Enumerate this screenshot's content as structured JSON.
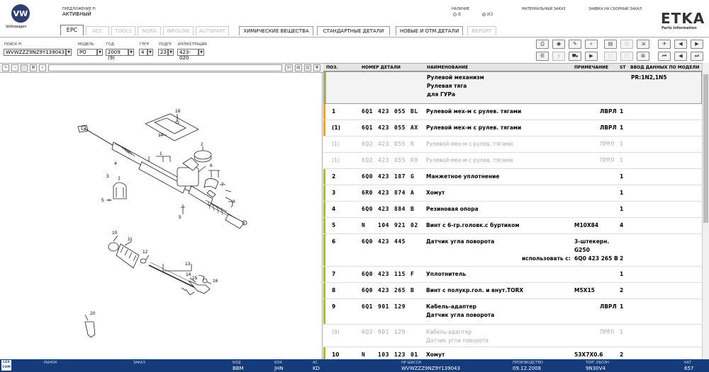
{
  "header": {
    "brand": "Volkswagen",
    "offer_label": "ПРЕДЛОЖЕНИЕ FI",
    "offer_value": "АКТИВНЫЙ",
    "availability_label": "НАЛИЧИЕ",
    "radio_b": "В",
    "radio_iz": "ИЗ",
    "material_order_label": "МАТЕРИАЛЬНЫЙ ЗАКАЗ",
    "assembly_order_label": "ЗАЯВКА НА СБОРНЫЙ ЗАКАЗ",
    "etka_title": "ETKA",
    "etka_subtitle": "Parts Information"
  },
  "tabs": [
    {
      "label": "EPC",
      "active": true
    },
    {
      "label": "ACC",
      "disabled": true
    },
    {
      "label": "TOOLS",
      "disabled": true
    },
    {
      "label": "NORA",
      "disabled": true
    },
    {
      "label": "INFOLINE",
      "disabled": true
    },
    {
      "label": "AUTOPART",
      "disabled": true
    },
    {
      "label": "ХИМИЧЕСКИЕ ВЕЩЕСТВА"
    },
    {
      "label": "СТАНДАРТНЫЕ ДЕТАЛИ"
    },
    {
      "label": "НОВЫЕ И ОТМ.ДЕТАЛИ"
    },
    {
      "label": "REPORT",
      "disabled": true
    }
  ],
  "search": {
    "search_label": "ПОИСК FI",
    "search_value": "WVWZZZ9NZ9Y139043",
    "model_label": "МОДЕЛЬ",
    "model_value": "PO",
    "year_label": "ГОД",
    "year_value": "2009 (9)",
    "group_label": "ГЛГР",
    "group_value": "4",
    "subgroup_label": "ПОДГР",
    "subgroup_value": "23",
    "illus_label": "ИЛЛЮСТРАЦИЯ",
    "illus_value": "423-020"
  },
  "table": {
    "headers": {
      "pos": "ПОЗ.",
      "part": "НОМЕР ДЕТАЛИ",
      "name": "НАИМЕНОВАНИЕ",
      "note": "ПРИМЕЧАНИЕ",
      "st": "ST",
      "model": "ВВОД ДАННЫХ ПО МОДЕЛИ"
    },
    "group_header": {
      "lines": [
        "Рулевой механизм",
        "Рулевая тяга",
        "для ГУРа"
      ],
      "model": "PR:1N2,1N5"
    },
    "rows": [
      {
        "pos": "1",
        "p1": "6Q1",
        "p2": "423",
        "p3": "055",
        "p4": "BL",
        "name": "Рулевой мех-м с рулев. тягами",
        "note": "ЛВРЛ",
        "st": "1",
        "bar": "#e8a33a"
      },
      {
        "pos": "(1)",
        "p1": "6Q1",
        "p2": "423",
        "p3": "055",
        "p4": "AX",
        "name": "Рулевой мех-м с рулев. тягами",
        "note": "ЛВРЛ",
        "st": "1",
        "bar": "#e8a33a"
      },
      {
        "pos": "(1)",
        "p1": "6Q2",
        "p2": "423",
        "p3": "055",
        "p4": "R",
        "name": "Рулевой мех-м с рулев. тягами",
        "note": "ПРРЛ",
        "st": "1",
        "gray": true
      },
      {
        "pos": "(1)",
        "p1": "6Q2",
        "p2": "423",
        "p3": "055",
        "p4": "RX",
        "name": "Рулевой мех-м с рулев. тягами",
        "note": "ПРРЛ",
        "st": "1",
        "gray": true
      },
      {
        "pos": "2",
        "p1": "6Q0",
        "p2": "423",
        "p3": "187",
        "p4": "G",
        "name": "Манжетное уплотнение",
        "note": "",
        "st": "1",
        "bar": "#a6b94a"
      },
      {
        "pos": "3",
        "p1": "6R0",
        "p2": "423",
        "p3": "874",
        "p4": "A",
        "name": "Хомут",
        "note": "",
        "st": "1",
        "bar": "#a6b94a"
      },
      {
        "pos": "4",
        "p1": "6Q0",
        "p2": "423",
        "p3": "884",
        "p4": "B",
        "name": "Резиновая опора",
        "note": "",
        "st": "1",
        "bar": "#a6b94a"
      },
      {
        "pos": "5",
        "p1": "N",
        "p2": "104",
        "p3": "921",
        "p4": "02",
        "name": "Винт с 6-гр.головк.с буртиком",
        "note": "M10X84",
        "st": "4",
        "bar": "#a6b94a"
      },
      {
        "pos": "6",
        "p1": "6Q0",
        "p2": "423",
        "p3": "445",
        "p4": "",
        "name": "Датчик угла поворота",
        "note": "3-штекерн.",
        "note2": "G250",
        "use_label": "использовать с:",
        "note3": "6Q0 423 265 B",
        "st": "2",
        "bar": "#a6b94a"
      },
      {
        "pos": "7",
        "p1": "6Q0",
        "p2": "423",
        "p3": "115",
        "p4": "F",
        "name": "Уплотнитель",
        "note": "",
        "st": "1",
        "bar": "#a6b94a"
      },
      {
        "pos": "8",
        "p1": "6Q0",
        "p2": "423",
        "p3": "265",
        "p4": "B",
        "name": "Винт с полукр.гол. и внут.TORX",
        "note": "M5X15",
        "st": "2",
        "bar": "#a6b94a"
      },
      {
        "pos": "9",
        "p1": "6Q1",
        "p2": "901",
        "p3": "129",
        "p4": "",
        "name": "Кабель-адаптер",
        "name2": "Датчик угла поворота",
        "note": "ЛВРЛ",
        "st": "1",
        "bar": "#a6b94a"
      },
      {
        "pos": "(9)",
        "p1": "6Q2",
        "p2": "901",
        "p3": "129",
        "p4": "",
        "name": "Кабель-адаптер",
        "name2": "Датчик угла поворота",
        "note": "ПРРЛ",
        "st": "1",
        "gray": true
      },
      {
        "pos": "10",
        "p1": "N",
        "p2": "103",
        "p3": "123",
        "p4": "01",
        "name": "Хомут",
        "note": "53X7X0.6",
        "st": "2",
        "bar": "#a6b94a"
      }
    ]
  },
  "diagram": {
    "labels": [
      "18",
      "17",
      "1",
      "2",
      "3",
      "4",
      "6",
      "7",
      "8",
      "5",
      "5",
      "10",
      "11",
      "12",
      "13",
      "14",
      "15",
      "16",
      "20"
    ]
  },
  "footer": {
    "logo": "LEX COM",
    "market_label": "РЫНОК",
    "order_label": "ЗАКАЗ",
    "bod_label": "БОД",
    "bod_value": "BBM",
    "bok_label": "БОК",
    "bok_value": "JHN",
    "ac_label": "АС",
    "ac_value": "KD",
    "vin_label": "НР ШАССИ",
    "vin_value": "WVWZZZ9NZ9Y139043",
    "prod_label": "ПРОИЗВОДСТВО",
    "prod_value": "09.12.2008",
    "trade_label": "ТОРГ.ОБОЗН",
    "trade_value": "9N30V4",
    "cat_label": "КАТ",
    "cat_value": "657"
  }
}
